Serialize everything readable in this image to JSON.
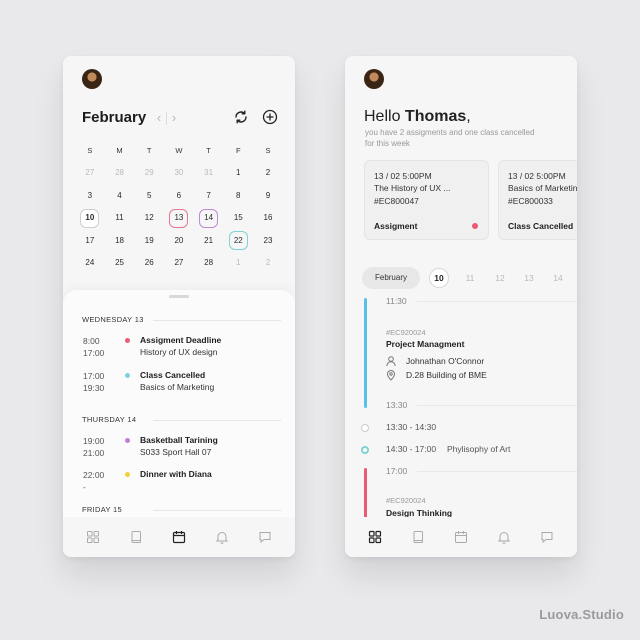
{
  "left": {
    "month": "February",
    "weekdays": [
      "S",
      "M",
      "T",
      "W",
      "T",
      "F",
      "S"
    ],
    "weeks": [
      [
        {
          "d": "27",
          "dim": true
        },
        {
          "d": "28",
          "dim": true
        },
        {
          "d": "29",
          "dim": true
        },
        {
          "d": "30",
          "dim": true
        },
        {
          "d": "31",
          "dim": true
        },
        {
          "d": "1"
        },
        {
          "d": "2"
        }
      ],
      [
        {
          "d": "3"
        },
        {
          "d": "4"
        },
        {
          "d": "5"
        },
        {
          "d": "6"
        },
        {
          "d": "7"
        },
        {
          "d": "8"
        },
        {
          "d": "9"
        }
      ],
      [
        {
          "d": "10",
          "mark": "today"
        },
        {
          "d": "11"
        },
        {
          "d": "12"
        },
        {
          "d": "13",
          "mark": "red"
        },
        {
          "d": "14",
          "mark": "purple"
        },
        {
          "d": "15"
        },
        {
          "d": "16"
        }
      ],
      [
        {
          "d": "17"
        },
        {
          "d": "18"
        },
        {
          "d": "19"
        },
        {
          "d": "20"
        },
        {
          "d": "21"
        },
        {
          "d": "22",
          "mark": "teal"
        },
        {
          "d": "23"
        }
      ],
      [
        {
          "d": "24"
        },
        {
          "d": "25"
        },
        {
          "d": "26"
        },
        {
          "d": "27"
        },
        {
          "d": "28"
        },
        {
          "d": "1",
          "dim": true
        },
        {
          "d": "2",
          "dim": true
        }
      ]
    ],
    "agenda": {
      "day1": "WEDNESDAY 13",
      "ev1": {
        "start": "8:00",
        "end": "17:00",
        "title": "Assigment Deadline",
        "sub": "History of UX design",
        "color": "#e85a76"
      },
      "ev2": {
        "start": "17:00",
        "end": "19:30",
        "title": "Class Cancelled",
        "sub": "Basics of Marketing",
        "color": "#7fd2dd"
      },
      "day2": "THURSDAY 14",
      "ev3": {
        "start": "19:00",
        "end": "21:00",
        "title": "Basketball Tarining",
        "sub": "S033 Sport Hall 07",
        "color": "#c07fd8"
      },
      "ev4": {
        "start": "22:00",
        "end": "-",
        "title": "Dinner with Diana",
        "color": "#f0d03c"
      },
      "day3": "FRIDAY 15"
    }
  },
  "right": {
    "greeting": "Hello",
    "name": "Thomas",
    "comma": ",",
    "subtitle": "you have 2 assigments and one class cancelled for this week",
    "card1": {
      "date": "13 / 02 5:00PM",
      "title": "The History of UX ...",
      "code": "#EC800047",
      "tag": "Assigment"
    },
    "card2": {
      "date": "13 / 02 5:00PM",
      "title": "Basics of Marketing",
      "code": "#EC800033",
      "tag": "Class Cancelled"
    },
    "month_pill": "February",
    "days": [
      "10",
      "11",
      "12",
      "13",
      "14"
    ],
    "timeline": {
      "t1": "11:30",
      "e1": {
        "code": "#EC920024",
        "title": "Project Managment",
        "person": "Johnathan O'Connor",
        "place": "D.28 Building of BME",
        "color": "#5bc0e8"
      },
      "t2": "13:30",
      "slot1": "13:30 - 14:30",
      "slot2": {
        "time": "14:30 - 17:00",
        "name": "Phylisophy of Art"
      },
      "t3": "17:00",
      "e2": {
        "code": "#EC920024",
        "title": "Design Thinking",
        "color": "#e85a76"
      }
    }
  },
  "brand": "Luova.Studio"
}
